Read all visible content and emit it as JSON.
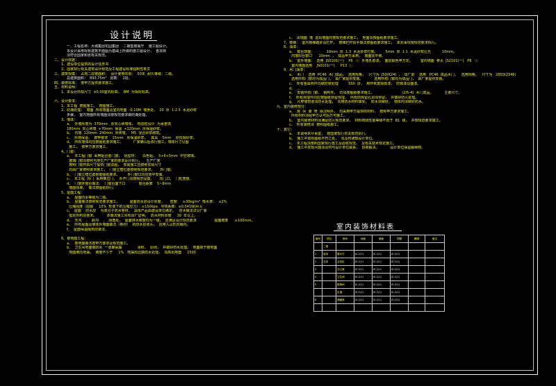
{
  "title": "设计说明",
  "left_lines": [
    {
      "t": "一、工程名称：大城集团花园集团    二期售楼展厅    施工图设计。",
      "c": "in w"
    },
    {
      "t": "本设计采用现有建筑平面图为基础上所做的施工图设计，  各项目",
      "c": "in w"
    },
    {
      "t": "须符合国家和省有关规范。",
      "c": "in w"
    },
    {
      "t": "二、设计依据：",
      "c": "hd"
    },
    {
      "t": "1、建设单位提供的设计任务书",
      "c": "sub"
    },
    {
      "t": "2、国家现行有关建筑设计规范及工程建设标准强制性条文",
      "c": "sub"
    },
    {
      "t": "三、建筑规模：  占地二层楼面积：  设计使用年限：  50年  耐久等级：二级。",
      "c": "hd"
    },
    {
      "t": "总建筑面积：  893.75m²   层数：  2层。",
      "c": "in w"
    },
    {
      "t": "四、装修标准：  按甲方提供要求施工。",
      "c": "hd"
    },
    {
      "t": "五、材料说明：",
      "c": "hd"
    },
    {
      "t": "1、本设计所标尺寸  ±0.00室内标高，  BM  为相对标高。",
      "c": "sub"
    },
    {
      "t": "",
      "c": "w"
    },
    {
      "t": "六、设计要求：",
      "c": "hd"
    },
    {
      "t": "1、本工程  按图施工，  按图施工。",
      "c": "sub"
    },
    {
      "t": "2、防潮处理：  墙面  所有墙面及室内地面  -0.10M  墙身处，  20  厚  1:2.5  水泥砂浆",
      "c": "sub"
    },
    {
      "t": "步骤，  室内地面所有墙面须按规范要求做防潮处理。",
      "c": "in w"
    },
    {
      "t": "3、墙体：",
      "c": "sub"
    },
    {
      "t": "a、  外墙厚度为  370mm   厚实心砖墙体，  构造柱设计  为承重墙",
      "c": "in y"
    },
    {
      "t": "180mm  实心砖墙  +70mm  保温  +120mm  厚保温砂浆。",
      "c": "in y"
    },
    {
      "t": "b、  内墙  120mm  240mm  厚砖墙，  M5  混合砂浆砌筑。",
      "c": "in y"
    },
    {
      "t": "c、  外墙保温，  按甲要求    15mm   厚保温砂浆，   其具    5mm    厚抗裂砂浆。",
      "c": "in y"
    },
    {
      "t": "d、  所有墙体均应按图纸要求施工。         厂家确认后再行施工，墙体尺寸见图",
      "c": "in y"
    },
    {
      "t": "  施工，  按甲方要求施工。",
      "c": "in y"
    },
    {
      "t": "4、门窗：",
      "c": "sub"
    },
    {
      "t": "a、  本工程门窗  采用铝合金门窗，  铝型材：    白色铝，  5+6+5mm  中空玻璃。",
      "c": "in y"
    },
    {
      "t": "  玻璃门窗须按照当地生产厂家的要求设计执行，    生产厂家",
      "c": "in y"
    },
    {
      "t": "  按照门窗开启尺寸提供门窗详图，  安装施工应按照实际尺寸",
      "c": "in y"
    },
    {
      "t": "  均由厂家按照要求施工，  门窗立樘位置按照规范要求。     外门窗。",
      "c": "in y"
    },
    {
      "t": "b、  门窗立樘位置根据图纸要求。       外门窗口均应居中安装。",
      "c": "in y"
    },
    {
      "t": "c、  本工程  外门  采用推拉门，  外开门须按规范设置。     向门口，  门框宽度。",
      "c": "in y"
    },
    {
      "t": "d、  门窗外窗台做法：  门窗台面下口            窗台距离    5~8mm",
      "c": "in y"
    },
    {
      "t": "  墙面找坡，  做法按图纸执行。",
      "c": "in y"
    },
    {
      "t": "5、屋面工程：",
      "c": "sub"
    },
    {
      "t": "a、  屋面防水等级为二级。",
      "c": "in y"
    },
    {
      "t": "b、  屋面做法按照规范要求施工。         屋面防水层设计厚度。     密度：  ≥30kg/m³  吸水率：  ≤2%",
      "c": "in y"
    },
    {
      "t": "  压缩强度（屈服     10%  形变下的压缩应力）：≥150kpa   导热系数：≤0.041W/m.k",
      "c": "in y"
    },
    {
      "t": "c、  屋面    防水层    为高分子防水卷材，  具体产品由建设单位确定。   防水做法详见厂家",
      "c": "in y"
    },
    {
      "t": "  指定的构造要求。         本做法施工须有出厂证明，  防水材料厚度     10  年以上。",
      "c": "in y"
    },
    {
      "t": "d、  天沟    、  斜沟    、  阴角处，  屋面排水坡度均为一级，  应满足设计规范要求                屋面坡度      ≥100mm。",
      "c": "in y"
    },
    {
      "t": "e、  所有屋面及墙体外墙面做法（卷材）  的防水层收头，  应用入山形凹槽内。",
      "c": "in y"
    },
    {
      "t": "f、  屋面保温隔热层做法。",
      "c": "in y"
    },
    {
      "t": "",
      "c": "w"
    },
    {
      "t": "6、楼地面工程：",
      "c": "sub"
    },
    {
      "t": "a、  楼地面做法按甲方要求及规范施工。",
      "c": "in y"
    },
    {
      "t": "b、  卫生间地面做防水  一道聚氨酯              涂料，  原则，  并做好防水处理。  地面高于楼地面",
      "c": "in y"
    },
    {
      "t": "  地面坡向地漏，  坡度不小于     1%   地漏周边做防水处理，  须高出地面     1500",
      "c": "in y"
    }
  ],
  "right_lines": [
    {
      "t": "c、  出墙面  墙  进出墙面均按规范要求施工，  地面须按图纸要求施工。",
      "c": "in y"
    },
    {
      "t": "7、楼梯：  室内楼梯踏步及栏杆，  楼梯栏杆扶手做法按图纸要求施工，  未完事项按规范要求执行。",
      "c": "sub"
    },
    {
      "t": "8、油漆：",
      "c": "sub"
    },
    {
      "t": "a、  窗台饰面：           10mm  厚  1:3  水泥砂浆打底，       5mm  厚  1:1  水泥砂浆压光          10mm。",
      "c": "in y"
    },
    {
      "t": "  内墙阳台窗口      10mm  ，  成品甲方采用，  墙面找平坡。",
      "c": "in y"
    },
    {
      "t": "b、  室外墙面：  选用  JS0101(一)    P6   ⓘ  外墙乳胶漆，  面层颜色甲方定。       室内墙面  参见  JS2101(一)   P8   ⓘ",
      "c": "in y"
    },
    {
      "t": "  室内墙面选用    JS0101(一)     P13  ⓘ",
      "c": "in y"
    },
    {
      "t": "9、木门油漆：",
      "c": "sub"
    },
    {
      "t": "a、  木门    选用  PC46  木门成品，  选用规格，   尺寸为  JS0(K24)  ，  出厂前    选用   PC46  成品木门，   选用规格，   尺寸为   2850(2346)",
      "c": "in y"
    },
    {
      "t": "  选用所有门窗均为成品门，  由厂家提供安装。          选用所有门窗均为成品门，  由厂家提供安装。",
      "c": "in y"
    },
    {
      "t": "c、  所有金属构件均做防锈处理         SS0  厚，  用环氧富锌底漆，  防锈漆及面漆。",
      "c": "in y"
    },
    {
      "t": "d、  ...",
      "c": "in y"
    },
    {
      "t": "e、  安装所有门窗、  钢构件，  均须按图纸要求施工。                         (2/5-4)  木门成品。          主要尺寸。",
      "c": "in y"
    },
    {
      "t": "f、  所有预埋件均应按图纸预留预埋，  所有的预留孔洞须预留，  并做好防火处理。",
      "c": "in y"
    },
    {
      "t": "g、  凡穿墙管道须防水处理，  须用防水材料填实，  防水须做好，  墙体内须做好防水。",
      "c": "in y"
    },
    {
      "t": "九、室内装修部分：",
      "c": "hd"
    },
    {
      "t": "a、  房  间  装  修  除注明外，  均采用甲方提供的材料，  按照甲方要求施工。",
      "c": "in y"
    },
    {
      "t": "  所有材料须经甲方认可后方可施工。",
      "c": "in y"
    },
    {
      "t": "b、  室内装修材料须满足防火规范要求，  材料燃烧性能等级不低于  B1  级，  并按规范要求施工。",
      "c": "in y"
    },
    {
      "t": "c、  所有装修须  按照图纸施工。",
      "c": "in y"
    },
    {
      "t": "十、其它：",
      "c": "hd"
    },
    {
      "t": "a、  本说明未尽事宜，  按国家现行有关规范执行。",
      "c": "in y"
    },
    {
      "t": "b、  施工中如有图纸不符之处，  须及时通知设计单位。",
      "c": "in y"
    },
    {
      "t": "c、  本工程须按照国家现行施工及验收规范，  及有关技术规定施工。",
      "c": "in y"
    },
    {
      "t": "d、  施工中发现问题须及时与设计单位联系，  协商解决。          设计单位保留解释权。",
      "c": "in y"
    }
  ],
  "table": {
    "title": "室内装饰材料表",
    "headers": [
      "编号",
      "项目",
      "房间",
      "地面",
      "墙面",
      "顶棚",
      "踢脚",
      "备注"
    ],
    "rows": [
      [
        "",
        "二楼",
        "",
        "",
        "",
        "",
        "",
        ""
      ],
      [
        "1",
        "接待",
        "展示厅",
        "JS-2(1)",
        "JS-2(1)",
        "JS-2(1)",
        "",
        ""
      ],
      [
        "2",
        "洽谈",
        "洽谈区",
        "JS-2(1)",
        "JS-2(1)",
        "JS-2(1)",
        "",
        ""
      ],
      [
        "3",
        "",
        "办公室",
        "JS-2(1)",
        "JS-2(1)",
        "JS-2(1)",
        "",
        ""
      ],
      [
        "4",
        "",
        "卫生间",
        "JS-2(1)",
        "JS-2(1)",
        "JS-2(1)",
        "",
        ""
      ],
      [
        "5",
        "",
        "楼梯间",
        "JS-2(1)",
        "JS-2(1)",
        "JS-2(1)",
        "",
        ""
      ],
      [
        "",
        "",
        "走道",
        "JS-2(1)",
        "JS-2(1)",
        "JS-2(1)",
        "",
        ""
      ],
      [
        "6",
        "",
        "储藏室",
        "JS-2(1)",
        "JS-2(1)",
        "JS-2(1)",
        "",
        ""
      ],
      [
        "",
        "",
        "",
        "",
        "",
        "",
        "",
        ""
      ]
    ]
  },
  "colors": {
    "text_white": "#e8e8e8",
    "text_yellow": "#f4ee3a",
    "frame": "#f2f2f2",
    "background": "#000000"
  }
}
